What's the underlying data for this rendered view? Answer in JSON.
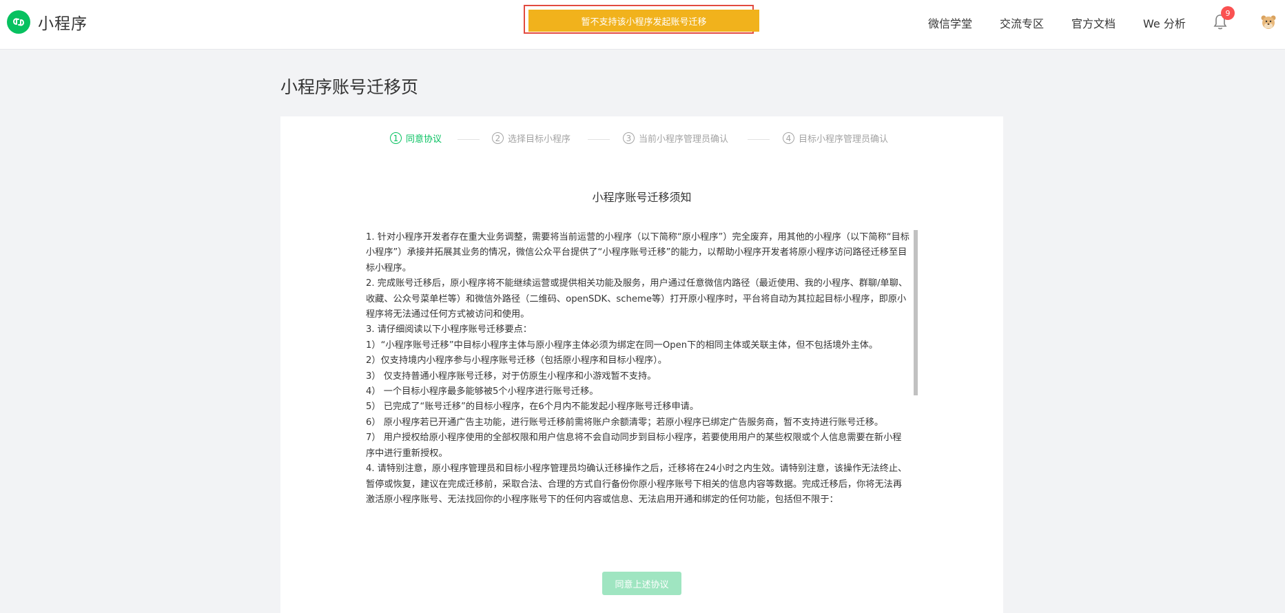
{
  "header": {
    "logo_text": "小程序",
    "notice": "暂不支持该小程序发起账号迁移",
    "nav": [
      "微信学堂",
      "交流专区",
      "官方文档",
      "We 分析"
    ],
    "notification_count": "9"
  },
  "page": {
    "title": "小程序账号迁移页"
  },
  "steps": [
    {
      "num": "1",
      "label": "同意协议"
    },
    {
      "num": "2",
      "label": "选择目标小程序"
    },
    {
      "num": "3",
      "label": "当前小程序管理员确认"
    },
    {
      "num": "4",
      "label": "目标小程序管理员确认"
    }
  ],
  "doc": {
    "title": "小程序账号迁移须知",
    "paragraphs": [
      "1. 针对小程序开发者存在重大业务调整，需要将当前运营的小程序（以下简称“原小程序”）完全废弃，用其他的小程序（以下简称“目标小程序”）承接并拓展其业务的情况，微信公众平台提供了“小程序账号迁移”的能力，以帮助小程序开发者将原小程序访问路径迁移至目标小程序。",
      "2. 完成账号迁移后，原小程序将不能继续运营或提供相关功能及服务，用户通过任意微信内路径（最近使用、我的小程序、群聊/单聊、收藏、公众号菜单栏等）和微信外路径（二维码、openSDK、scheme等）打开原小程序时，平台将自动为其拉起目标小程序，即原小程序将无法通过任何方式被访问和使用。",
      "3. 请仔细阅读以下小程序账号迁移要点：",
      "1）“小程序账号迁移”中目标小程序主体与原小程序主体必须为绑定在同一Open下的相同主体或关联主体，但不包括境外主体。",
      "2）仅支持境内小程序参与小程序账号迁移（包括原小程序和目标小程序）。",
      "3） 仅支持普通小程序账号迁移，对于仿原生小程序和小游戏暂不支持。",
      "4） 一个目标小程序最多能够被5个小程序进行账号迁移。",
      "5） 已完成了“账号迁移”的目标小程序，在6个月内不能发起小程序账号迁移申请。",
      "6） 原小程序若已开通广告主功能，进行账号迁移前需将账户余额清零；若原小程序已绑定广告服务商，暂不支持进行账号迁移。",
      "7） 用户授权给原小程序使用的全部权限和用户信息将不会自动同步到目标小程序，若要使用用户的某些权限或个人信息需要在新小程序中进行重新授权。",
      "4. 请特别注意，原小程序管理员和目标小程序管理员均确认迁移操作之后，迁移将在24小时之内生效。请特别注意，该操作无法终止、暂停或恢复，建议在完成迁移前，采取合法、合理的方式自行备份你原小程序账号下相关的信息内容等数据。完成迁移后，你将无法再激活原小程序账号、无法找回你的小程序账号下的任何内容或信息、无法启用开通和绑定的任何功能，包括但不限于："
    ]
  },
  "agree_button": "同意上述协议"
}
